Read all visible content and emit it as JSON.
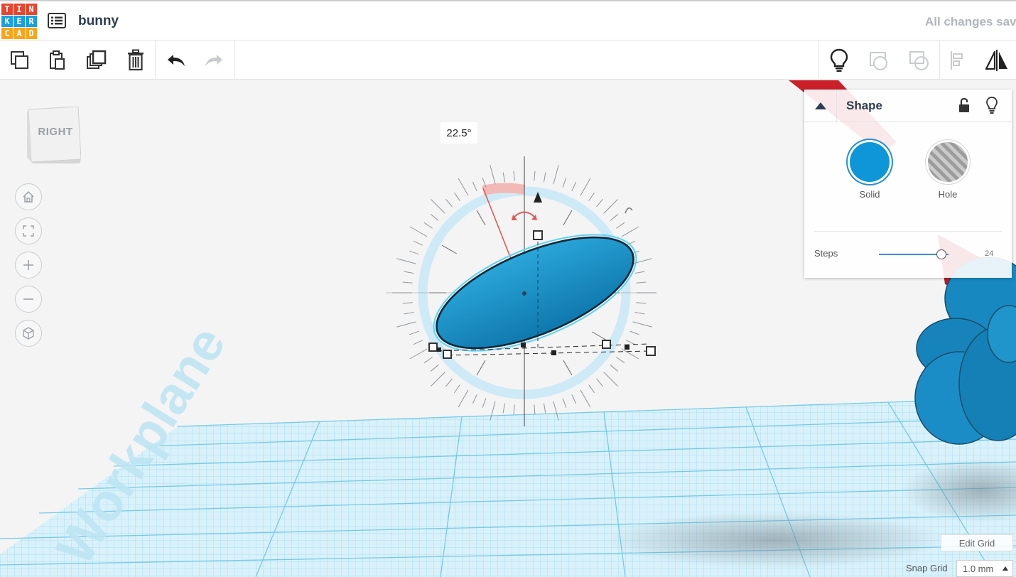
{
  "app": {
    "logo_letters": [
      "T",
      "I",
      "N",
      "K",
      "E",
      "R",
      "C",
      "A",
      "D"
    ],
    "logo_colors": [
      "#e8442e",
      "#e8442e",
      "#e8442e",
      "#1aa0df",
      "#1aa0df",
      "#1aa0df",
      "#f7a51c",
      "#f7a51c",
      "#f7a51c"
    ],
    "project_title": "bunny",
    "save_status": "All changes saved"
  },
  "toolbar": {
    "left_icons": [
      "copy-icon",
      "paste-icon",
      "duplicate-icon",
      "delete-icon",
      "undo-icon",
      "redo-icon"
    ],
    "right_icons": [
      "lightbulb-icon",
      "group-icon",
      "ungroup-icon",
      "align-icon",
      "mirror-icon"
    ]
  },
  "viewcube": {
    "face_label": "RIGHT"
  },
  "nav": {
    "buttons": [
      "home-view-icon",
      "fit-view-icon",
      "zoom-in-icon",
      "zoom-out-icon",
      "perspective-icon"
    ]
  },
  "rotation": {
    "angle_label": "22.5°"
  },
  "workplane": {
    "label": "Workplane"
  },
  "shape_panel": {
    "title": "Shape",
    "solid_label": "Solid",
    "hole_label": "Hole",
    "solid_color": "#0e96d8",
    "steps_label": "Steps",
    "steps_value": "24",
    "steps_fraction": 0.9
  },
  "grid": {
    "edit_label": "Edit Grid",
    "snap_label": "Snap Grid",
    "snap_value": "1.0 mm"
  },
  "colors": {
    "accent": "#1aa0df",
    "grid_blue": "#8fd3ea",
    "shape_blue": "#1a8fc6"
  }
}
